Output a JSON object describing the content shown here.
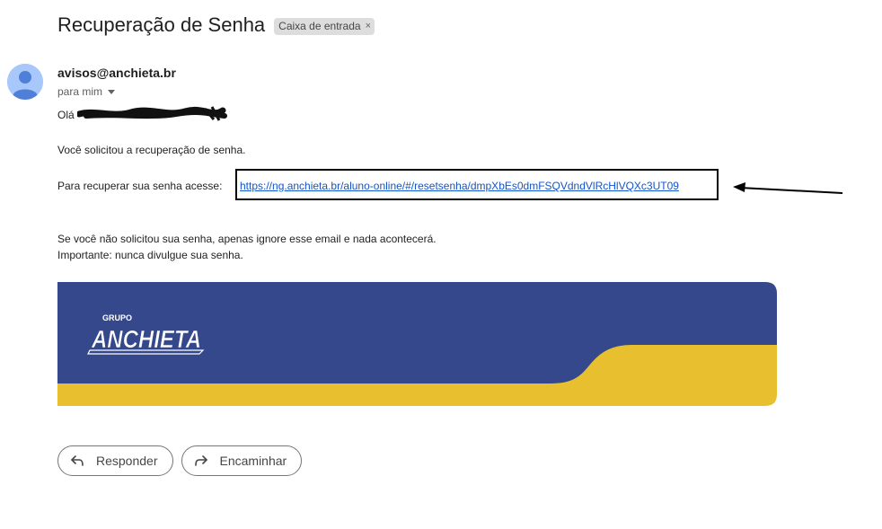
{
  "email": {
    "subject": "Recuperação de Senha",
    "label": "Caixa de entrada",
    "label_close_glyph": "×",
    "sender": "avisos@anchieta.br",
    "recipient": "para mim"
  },
  "message": {
    "greeting": "Olá",
    "line_requested": "Você solicitou a recuperação de senha.",
    "line_recover_prefix": "Para recuperar sua senha acesse:",
    "reset_link": "https://ng.anchieta.br/aluno-online/#/resetsenha/dmpXbEs0dmFSQVdndVlRcHlVQXc3UT09",
    "line_ignore": "Se você não solicitou sua senha, apenas ignore esse email e nada acontecerá.",
    "line_important": "Importante: nunca divulgue sua senha."
  },
  "banner": {
    "brand_small": "GRUPO",
    "brand_name": "ANCHIETA",
    "colors": {
      "blue": "#34488b",
      "yellow": "#e8c02f"
    }
  },
  "actions": {
    "reply_label": "Responder",
    "forward_label": "Encaminhar"
  },
  "icons": {
    "avatar": "person-avatar-icon",
    "reply": "reply-icon",
    "forward": "forward-icon",
    "annotation": "arrow-left-icon"
  }
}
